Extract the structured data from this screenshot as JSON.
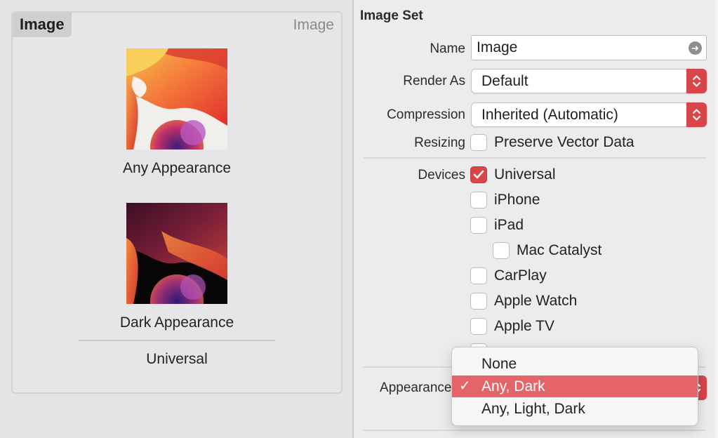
{
  "left_panel": {
    "group_tab": "Image",
    "group_name": "Image",
    "slots": [
      {
        "label": "Any Appearance"
      },
      {
        "label": "Dark Appearance"
      }
    ],
    "footer_label": "Universal"
  },
  "inspector": {
    "section_title": "Image Set",
    "name": {
      "label": "Name",
      "value": "Image"
    },
    "render_as": {
      "label": "Render As",
      "value": "Default"
    },
    "compression": {
      "label": "Compression",
      "value": "Inherited (Automatic)"
    },
    "resizing": {
      "label": "Resizing",
      "option": "Preserve Vector Data",
      "checked": false
    },
    "devices": {
      "label": "Devices",
      "items": [
        {
          "label": "Universal",
          "checked": true
        },
        {
          "label": "iPhone",
          "checked": false
        },
        {
          "label": "iPad",
          "checked": false
        },
        {
          "label": "Mac Catalyst",
          "checked": false
        },
        {
          "label": "CarPlay",
          "checked": false
        },
        {
          "label": "Apple Watch",
          "checked": false
        },
        {
          "label": "Apple TV",
          "checked": false
        }
      ]
    },
    "appearances": {
      "label": "Appearances"
    }
  },
  "appearance_menu": {
    "items": [
      {
        "label": "None",
        "selected": false
      },
      {
        "label": "Any, Dark",
        "selected": true
      },
      {
        "label": "Any, Light, Dark",
        "selected": false
      }
    ],
    "check_glyph": "✓"
  },
  "colors": {
    "accent": "#d9464a",
    "menu_highlight": "#e5646a"
  },
  "icons": {
    "goto": "arrow-right-circle-icon",
    "stepper": "up-down-chevron-icon",
    "check": "checkmark-icon"
  }
}
